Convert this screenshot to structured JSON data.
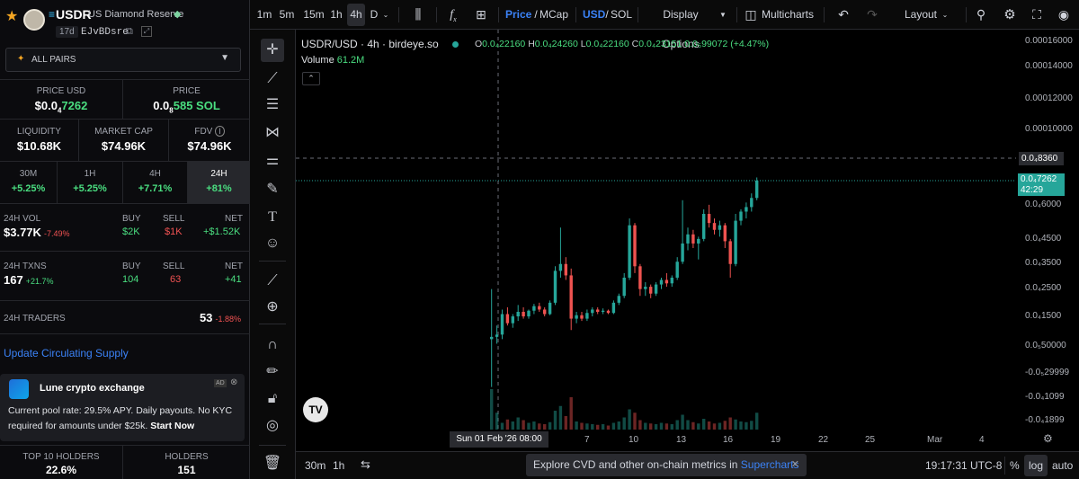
{
  "token": {
    "symbol": "USDR",
    "name": "US Diamond Reserve",
    "age": "17d",
    "address": "EJvBDsre"
  },
  "pairs_dropdown": "ALL PAIRS",
  "price_usd": {
    "label": "PRICE USD",
    "value_prefix": "$0.0",
    "sub": "4",
    "value_tail": "7262"
  },
  "price_sol": {
    "label": "PRICE",
    "value_prefix": "0.0",
    "sub": "8",
    "value_tail": "585 SOL"
  },
  "liquidity": {
    "label": "LIQUIDITY",
    "value": "$10.68K"
  },
  "market_cap": {
    "label": "MARKET CAP",
    "value": "$74.96K"
  },
  "fdv": {
    "label": "FDV",
    "value": "$74.96K"
  },
  "timeframes": [
    {
      "label": "30M",
      "value": "+5.25%"
    },
    {
      "label": "1H",
      "value": "+5.25%"
    },
    {
      "label": "4H",
      "value": "+7.71%"
    },
    {
      "label": "24H",
      "value": "+81%"
    }
  ],
  "vol": {
    "label": "24H VOL",
    "value": "$3.77K",
    "change": "-7.49%",
    "buy_label": "BUY",
    "buy": "$2K",
    "sell_label": "SELL",
    "sell": "$1K",
    "net_label": "NET",
    "net": "+$1.52K"
  },
  "txns": {
    "label": "24H TXNS",
    "value": "167",
    "change": "+21.7%",
    "buy_label": "BUY",
    "buy": "104",
    "sell_label": "SELL",
    "sell": "63",
    "net_label": "NET",
    "net": "+41"
  },
  "traders": {
    "label": "24H TRADERS",
    "value": "53",
    "change": "-1.88%"
  },
  "update_link": "Update Circulating Supply",
  "ad": {
    "title": "Lune crypto exchange",
    "badge": "AD",
    "body": "Current pool rate: 29.5% APY. Daily payouts. No KYC required for amounts under $25k.",
    "cta": "Start Now"
  },
  "holders": {
    "top_label": "TOP 10 HOLDERS",
    "top_value": "22.6%",
    "label": "HOLDERS",
    "value": "151"
  },
  "toolbar": {
    "intervals": [
      "1m",
      "5m",
      "15m",
      "1h",
      "4h",
      "D"
    ],
    "price_label": "Price",
    "mcap_label": "MCap",
    "usd_label": "USD",
    "sol_label": "SOL",
    "display_options": "Display Options",
    "multicharts": "Multicharts",
    "layout": "Layout"
  },
  "legend": {
    "pair": "USDR/USD · 4h · birdeye.so",
    "o_label": "O",
    "o_val": "0.0₄22160",
    "h_label": "H",
    "h_val": "0.0₄24260",
    "l_label": "L",
    "l_val": "0.0₄22160",
    "c_label": "C",
    "c_val": "0.0₄23151",
    "change": "0.0₅99072 (+4.47%)",
    "volume_label": "Volume",
    "volume_val": "61.2M"
  },
  "price_axis": [
    "0.00016000",
    "0.00014000",
    "0.00012000",
    "0.00010000",
    "0.0₄6000",
    "0.0₄4500",
    "0.0₄3500",
    "0.0₄2500",
    "0.0₄1500",
    "0.0₅50000",
    "-0.0₅29999",
    "-0.0₄1099",
    "-0.0₄1899"
  ],
  "crosshair_price": "0.0₄8360",
  "current_price": "0.0₄7262",
  "countdown": "42:29",
  "time_axis": [
    "7",
    "10",
    "13",
    "16",
    "19",
    "22",
    "25",
    "Mar",
    "4"
  ],
  "crosshair_time": "Sun 01 Feb '26   08:00",
  "bottom": {
    "r1": "30m",
    "r2": "1h",
    "banner": "Explore CVD and other on-chain metrics in ",
    "banner_link": "Supercharts",
    "clock": "19:17:31 UTC-8",
    "pct": "%",
    "log": "log",
    "auto": "auto"
  },
  "chart_data": {
    "type": "candlestick",
    "interval": "4h",
    "series": [
      {
        "name": "USDR/USD",
        "candles": [
          {
            "o": 0.3,
            "h": 2.5,
            "l": -1.8,
            "c": 0.4
          },
          {
            "o": 0.4,
            "h": 0.9,
            "l": 0.1,
            "c": 0.5
          },
          {
            "o": 0.5,
            "h": 1.6,
            "l": 0.3,
            "c": 1.4
          },
          {
            "o": 1.4,
            "h": 1.7,
            "l": 0.9,
            "c": 1.0
          },
          {
            "o": 1.0,
            "h": 1.4,
            "l": 0.8,
            "c": 1.3
          },
          {
            "o": 1.3,
            "h": 1.8,
            "l": 1.1,
            "c": 1.5
          },
          {
            "o": 1.5,
            "h": 1.7,
            "l": 1.2,
            "c": 1.3
          },
          {
            "o": 1.3,
            "h": 1.6,
            "l": 1.2,
            "c": 1.55
          },
          {
            "o": 1.55,
            "h": 1.85,
            "l": 1.4,
            "c": 1.75
          },
          {
            "o": 1.75,
            "h": 1.9,
            "l": 1.5,
            "c": 1.6
          },
          {
            "o": 1.6,
            "h": 1.7,
            "l": 1.3,
            "c": 1.4
          },
          {
            "o": 1.4,
            "h": 2.0,
            "l": 1.35,
            "c": 1.9
          },
          {
            "o": 1.9,
            "h": 3.5,
            "l": 1.8,
            "c": 3.3
          },
          {
            "o": 3.3,
            "h": 5.2,
            "l": 3.0,
            "c": 3.6
          },
          {
            "o": 3.6,
            "h": 3.9,
            "l": 2.9,
            "c": 3.1
          },
          {
            "o": 3.1,
            "h": 3.4,
            "l": 0.7,
            "c": 1.2
          },
          {
            "o": 1.2,
            "h": 1.5,
            "l": 1.0,
            "c": 1.35
          },
          {
            "o": 1.35,
            "h": 1.5,
            "l": 1.1,
            "c": 1.2
          },
          {
            "o": 1.2,
            "h": 1.6,
            "l": 1.1,
            "c": 1.45
          },
          {
            "o": 1.45,
            "h": 1.7,
            "l": 1.3,
            "c": 1.6
          },
          {
            "o": 1.6,
            "h": 1.7,
            "l": 1.4,
            "c": 1.5
          },
          {
            "o": 1.5,
            "h": 1.65,
            "l": 1.4,
            "c": 1.55
          },
          {
            "o": 1.55,
            "h": 1.6,
            "l": 1.4,
            "c": 1.45
          },
          {
            "o": 1.45,
            "h": 2.0,
            "l": 1.4,
            "c": 1.9
          },
          {
            "o": 1.9,
            "h": 2.3,
            "l": 1.8,
            "c": 2.2
          },
          {
            "o": 2.2,
            "h": 3.2,
            "l": 2.1,
            "c": 3.0
          },
          {
            "o": 3.0,
            "h": 5.6,
            "l": 2.9,
            "c": 5.3
          },
          {
            "o": 5.3,
            "h": 5.4,
            "l": 3.2,
            "c": 3.5
          },
          {
            "o": 3.5,
            "h": 3.6,
            "l": 2.2,
            "c": 2.5
          },
          {
            "o": 2.5,
            "h": 2.8,
            "l": 2.2,
            "c": 2.6
          },
          {
            "o": 2.6,
            "h": 2.7,
            "l": 2.1,
            "c": 2.3
          },
          {
            "o": 2.3,
            "h": 2.8,
            "l": 2.2,
            "c": 2.7
          },
          {
            "o": 2.7,
            "h": 3.0,
            "l": 2.5,
            "c": 2.9
          },
          {
            "o": 2.9,
            "h": 3.2,
            "l": 2.6,
            "c": 2.75
          },
          {
            "o": 2.75,
            "h": 3.1,
            "l": 2.6,
            "c": 3.0
          },
          {
            "o": 3.0,
            "h": 3.9,
            "l": 2.9,
            "c": 3.7
          },
          {
            "o": 3.7,
            "h": 6.4,
            "l": 3.6,
            "c": 4.5
          },
          {
            "o": 4.5,
            "h": 5.2,
            "l": 4.2,
            "c": 4.9
          },
          {
            "o": 4.9,
            "h": 5.1,
            "l": 4.3,
            "c": 4.5
          },
          {
            "o": 4.5,
            "h": 4.8,
            "l": 3.8,
            "c": 4.7
          },
          {
            "o": 4.7,
            "h": 6.0,
            "l": 4.6,
            "c": 5.8
          },
          {
            "o": 5.8,
            "h": 6.2,
            "l": 5.2,
            "c": 5.4
          },
          {
            "o": 5.4,
            "h": 5.6,
            "l": 4.9,
            "c": 5.1
          },
          {
            "o": 5.1,
            "h": 5.5,
            "l": 4.8,
            "c": 5.3
          },
          {
            "o": 5.3,
            "h": 5.4,
            "l": 4.3,
            "c": 4.6
          },
          {
            "o": 4.6,
            "h": 4.7,
            "l": 3.0,
            "c": 3.6
          },
          {
            "o": 3.6,
            "h": 5.8,
            "l": 3.5,
            "c": 5.5
          },
          {
            "o": 5.5,
            "h": 6.0,
            "l": 5.3,
            "c": 5.9
          },
          {
            "o": 5.9,
            "h": 6.3,
            "l": 5.6,
            "c": 6.1
          },
          {
            "o": 6.1,
            "h": 6.7,
            "l": 5.9,
            "c": 6.5
          },
          {
            "o": 6.5,
            "h": 7.4,
            "l": 6.4,
            "c": 7.26
          }
        ]
      }
    ],
    "volume": [
      60,
      25,
      10,
      15,
      12,
      18,
      14,
      10,
      12,
      9,
      8,
      11,
      28,
      35,
      20,
      48,
      12,
      10,
      9,
      8,
      7,
      8,
      6,
      10,
      12,
      18,
      30,
      25,
      14,
      10,
      9,
      8,
      10,
      9,
      8,
      14,
      22,
      14,
      11,
      9,
      16,
      12,
      9,
      10,
      13,
      18,
      15,
      12,
      11,
      13,
      25
    ],
    "y_unit": "0.0₄ USD",
    "ylim": [
      -1.9,
      16.0
    ],
    "xlabel": "",
    "ylabel": ""
  }
}
